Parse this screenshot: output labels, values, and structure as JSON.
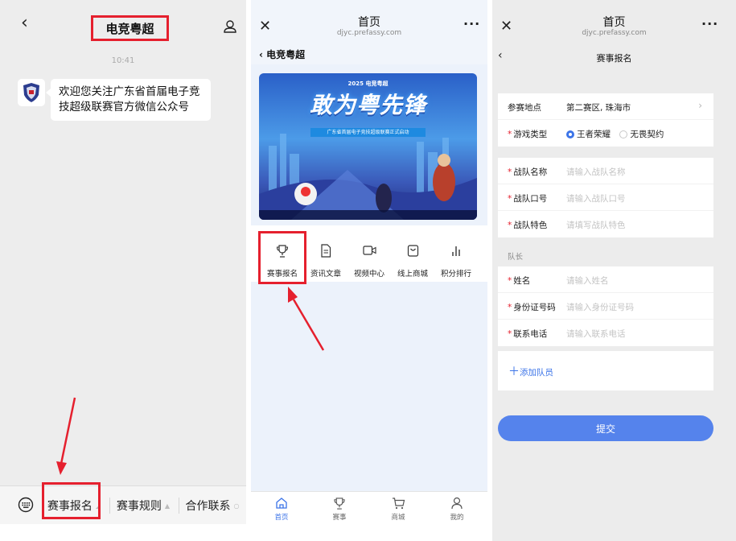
{
  "chat": {
    "title": "电竞粤超",
    "time": "10:41",
    "message": "欢迎您关注广东省首届电子竞技超级联赛官方微信公众号",
    "menu": [
      "赛事报名",
      "赛事规则",
      "合作联系"
    ]
  },
  "home": {
    "title": "首页",
    "url": "djyc.prefassy.com",
    "nav_label": "电竞粤超",
    "banner": {
      "year_tag": "2025 电竞粤超",
      "headline": "敢为粤先锋",
      "subline": "广东省首届电子竞技超级联赛正式启动"
    },
    "menu": [
      {
        "label": "赛事报名",
        "icon": "trophy-icon"
      },
      {
        "label": "资讯文章",
        "icon": "document-icon"
      },
      {
        "label": "视频中心",
        "icon": "video-icon"
      },
      {
        "label": "线上商城",
        "icon": "shopping-bag-icon"
      },
      {
        "label": "积分排行",
        "icon": "bar-chart-icon"
      }
    ],
    "tabs": [
      {
        "label": "首页",
        "icon": "home-icon",
        "active": true
      },
      {
        "label": "赛事",
        "icon": "trophy-icon",
        "active": false
      },
      {
        "label": "商城",
        "icon": "cart-icon",
        "active": false
      },
      {
        "label": "我的",
        "icon": "user-icon",
        "active": false
      }
    ]
  },
  "form": {
    "title": "首页",
    "url": "djyc.prefassy.com",
    "page_title": "赛事报名",
    "location_label": "参赛地点",
    "location_value": "第二赛区, 珠海市",
    "game_label": "游戏类型",
    "game_options": [
      "王者荣耀",
      "无畏契约"
    ],
    "team": [
      {
        "label": "战队名称",
        "placeholder": "请输入战队名称"
      },
      {
        "label": "战队口号",
        "placeholder": "请输入战队口号"
      },
      {
        "label": "战队特色",
        "placeholder": "请填写战队特色"
      }
    ],
    "captain_section": "队长",
    "captain": [
      {
        "label": "姓名",
        "placeholder": "请输入姓名"
      },
      {
        "label": "身份证号码",
        "placeholder": "请输入身份证号码"
      },
      {
        "label": "联系电话",
        "placeholder": "请输入联系电话"
      }
    ],
    "add_member": "添加队员",
    "submit": "提交"
  },
  "colors": {
    "accent": "#3c74e8",
    "highlight": "#e5202e",
    "submit": "#5583ec"
  }
}
